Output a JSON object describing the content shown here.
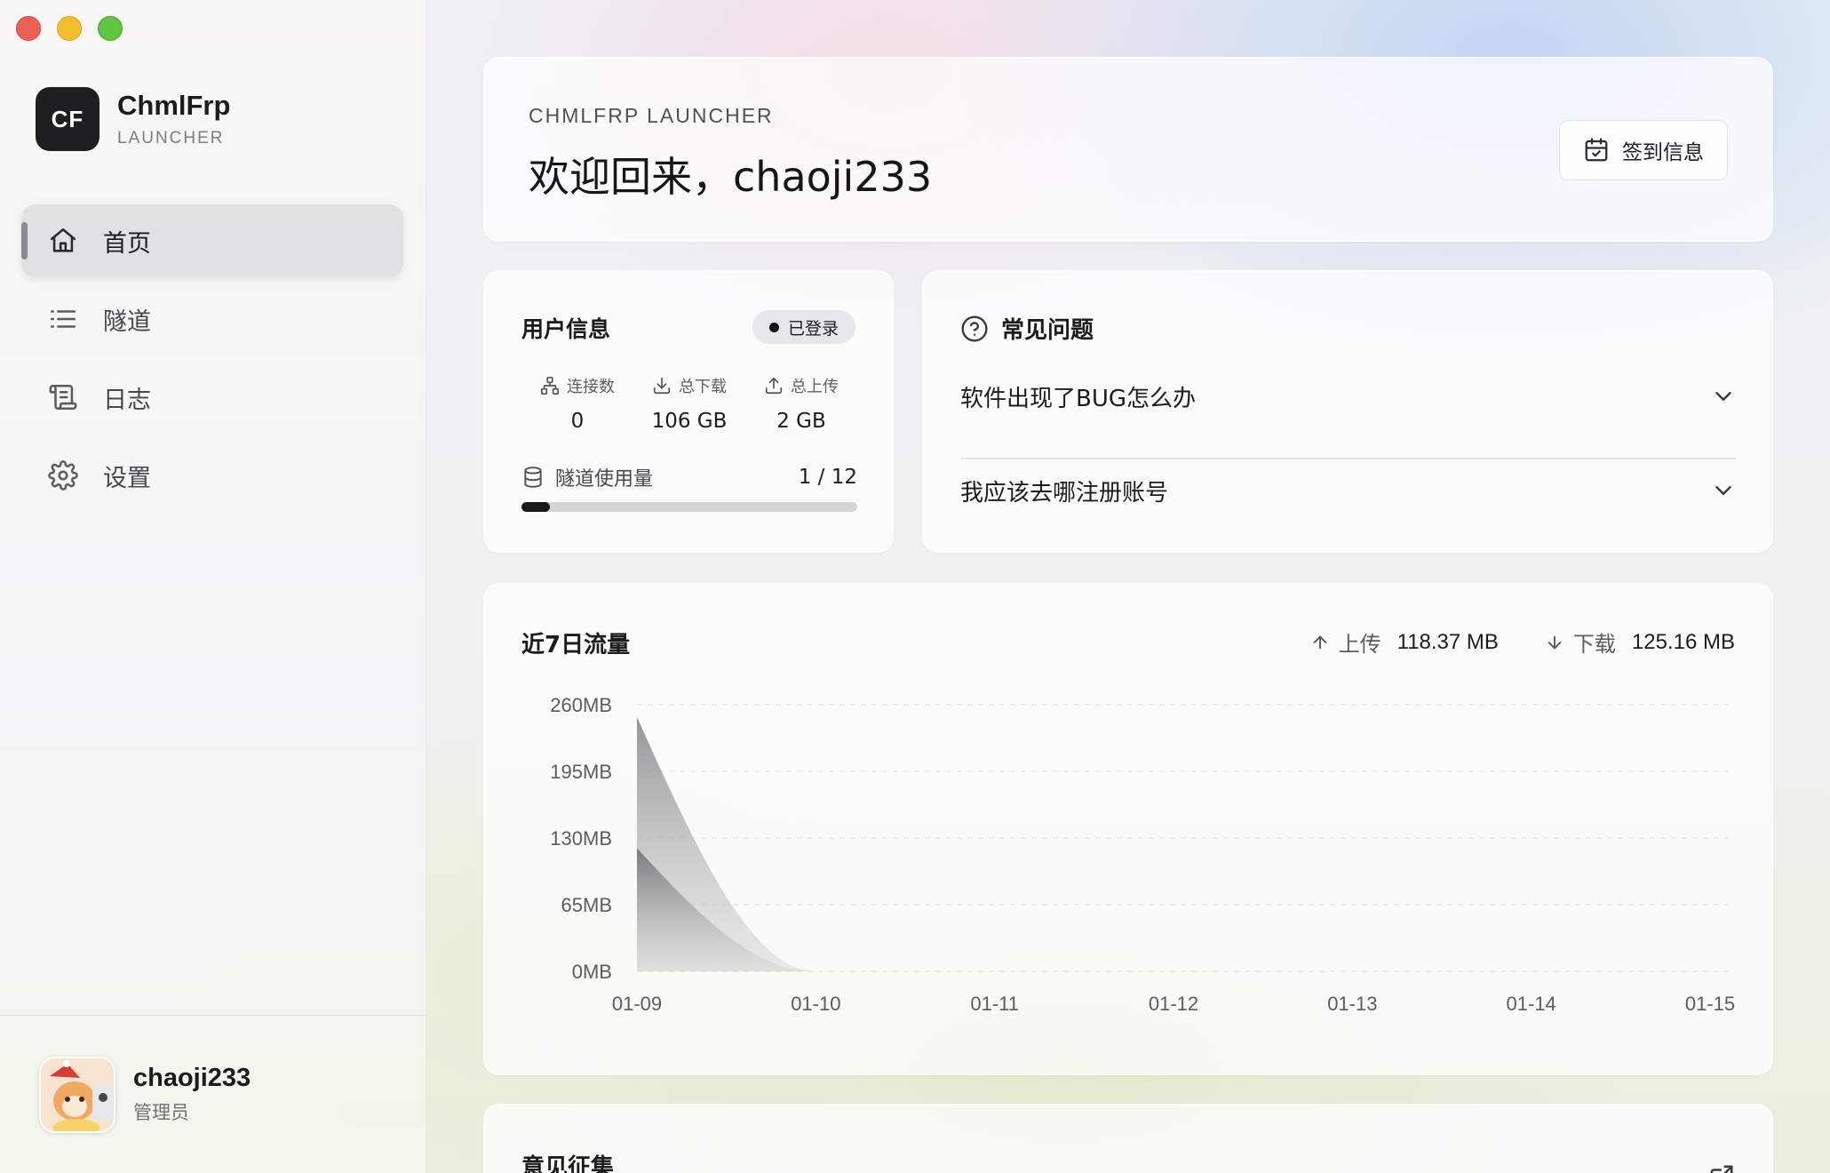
{
  "sidebar": {
    "brand_logo": "CF",
    "brand_name": "ChmlFrp",
    "brand_sub": "LAUNCHER",
    "nav": [
      {
        "label": "首页",
        "icon": "home-icon",
        "active": true
      },
      {
        "label": "隧道",
        "icon": "list-icon",
        "active": false
      },
      {
        "label": "日志",
        "icon": "scroll-icon",
        "active": false
      },
      {
        "label": "设置",
        "icon": "gear-icon",
        "active": false
      }
    ],
    "user": {
      "name": "chaoji233",
      "role": "管理员"
    }
  },
  "welcome": {
    "eyebrow": "CHMLFRP LAUNCHER",
    "title": "欢迎回来，chaoji233",
    "checkin_label": "签到信息"
  },
  "user_info": {
    "title": "用户信息",
    "status": "已登录",
    "stats": [
      {
        "label": "连接数",
        "value": "0",
        "icon": "network-icon"
      },
      {
        "label": "总下载",
        "value": "106 GB",
        "icon": "download-icon"
      },
      {
        "label": "总上传",
        "value": "2 GB",
        "icon": "upload-icon"
      }
    ],
    "usage_label": "隧道使用量",
    "usage_value": "1 / 12",
    "usage_used": 1,
    "usage_total": 12
  },
  "faq": {
    "title": "常见问题",
    "items": [
      {
        "question": "软件出现了BUG怎么办"
      },
      {
        "question": "我应该去哪注册账号"
      }
    ]
  },
  "traffic": {
    "title": "近7日流量",
    "upload_label": "上传",
    "upload_value": "118.37 MB",
    "download_label": "下载",
    "download_value": "125.16 MB"
  },
  "feedback": {
    "title": "意见征集"
  },
  "chart_data": {
    "type": "area",
    "categories": [
      "01-09",
      "01-10",
      "01-11",
      "01-12",
      "01-13",
      "01-14",
      "01-15"
    ],
    "y_ticks": [
      "0MB",
      "65MB",
      "130MB",
      "195MB",
      "260MB"
    ],
    "ylim": [
      0,
      260
    ],
    "series": [
      {
        "values": [
          248,
          0,
          0,
          0,
          0,
          0,
          0
        ],
        "color": "#9a9c9e"
      },
      {
        "values": [
          120,
          0,
          0,
          0,
          0,
          0,
          0
        ],
        "color": "#6f7173"
      }
    ],
    "grid": true,
    "colors": {
      "grid": "#e3e5e7",
      "tick": "#5a5c5f"
    }
  }
}
